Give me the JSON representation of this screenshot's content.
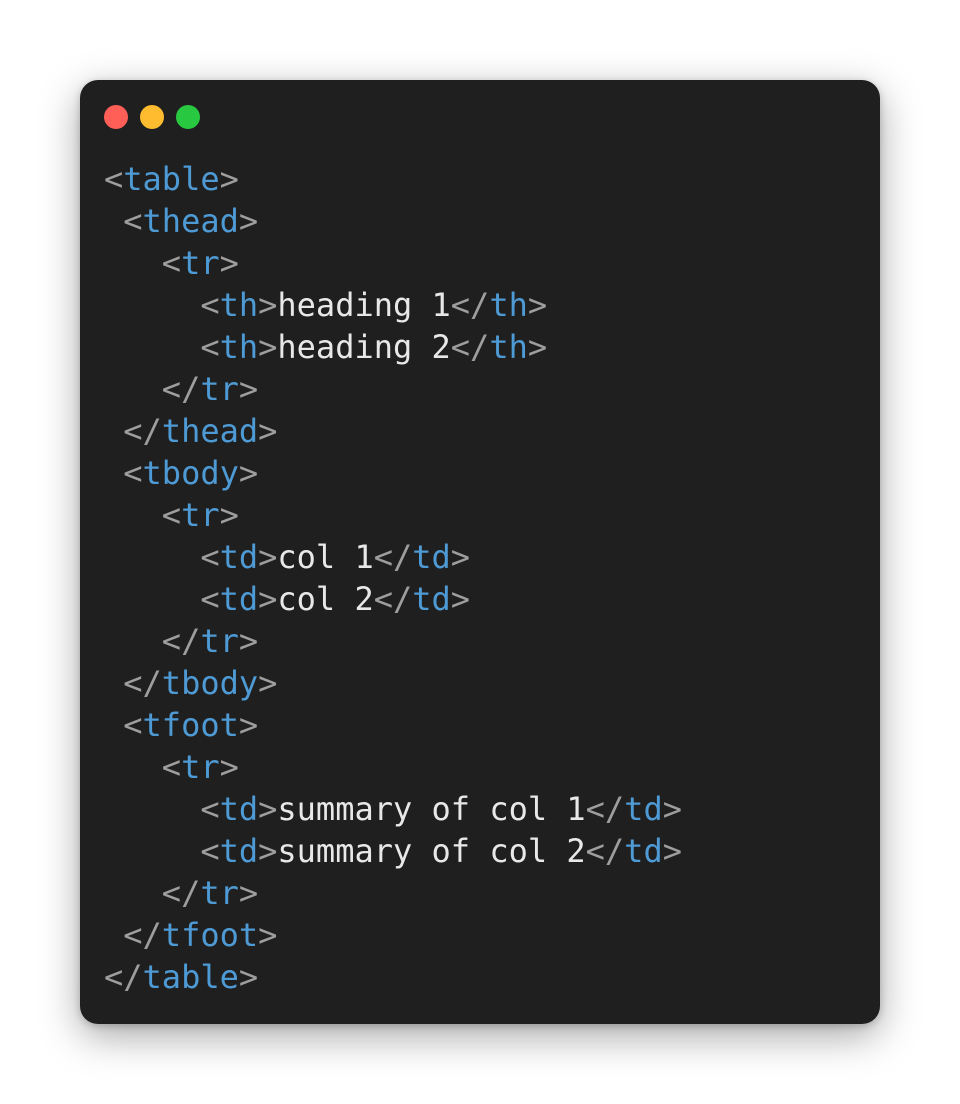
{
  "window_controls": {
    "close_color": "#ff5f57",
    "minimize_color": "#febc2e",
    "maximize_color": "#28c840"
  },
  "colors": {
    "background": "#1f1f1f",
    "punctuation": "#9e9e9e",
    "tag": "#4e9ad5",
    "text": "#e8e8e8"
  },
  "code": {
    "lines": [
      [
        {
          "t": "p",
          "v": "<"
        },
        {
          "t": "g",
          "v": "table"
        },
        {
          "t": "p",
          "v": ">"
        }
      ],
      [
        {
          "t": "s",
          "v": " "
        },
        {
          "t": "p",
          "v": "<"
        },
        {
          "t": "g",
          "v": "thead"
        },
        {
          "t": "p",
          "v": ">"
        }
      ],
      [
        {
          "t": "s",
          "v": "   "
        },
        {
          "t": "p",
          "v": "<"
        },
        {
          "t": "g",
          "v": "tr"
        },
        {
          "t": "p",
          "v": ">"
        }
      ],
      [
        {
          "t": "s",
          "v": "     "
        },
        {
          "t": "p",
          "v": "<"
        },
        {
          "t": "g",
          "v": "th"
        },
        {
          "t": "p",
          "v": ">"
        },
        {
          "t": "x",
          "v": "heading 1"
        },
        {
          "t": "p",
          "v": "</"
        },
        {
          "t": "g",
          "v": "th"
        },
        {
          "t": "p",
          "v": ">"
        }
      ],
      [
        {
          "t": "s",
          "v": "     "
        },
        {
          "t": "p",
          "v": "<"
        },
        {
          "t": "g",
          "v": "th"
        },
        {
          "t": "p",
          "v": ">"
        },
        {
          "t": "x",
          "v": "heading 2"
        },
        {
          "t": "p",
          "v": "</"
        },
        {
          "t": "g",
          "v": "th"
        },
        {
          "t": "p",
          "v": ">"
        }
      ],
      [
        {
          "t": "s",
          "v": "   "
        },
        {
          "t": "p",
          "v": "</"
        },
        {
          "t": "g",
          "v": "tr"
        },
        {
          "t": "p",
          "v": ">"
        }
      ],
      [
        {
          "t": "s",
          "v": " "
        },
        {
          "t": "p",
          "v": "</"
        },
        {
          "t": "g",
          "v": "thead"
        },
        {
          "t": "p",
          "v": ">"
        }
      ],
      [
        {
          "t": "s",
          "v": " "
        },
        {
          "t": "p",
          "v": "<"
        },
        {
          "t": "g",
          "v": "tbody"
        },
        {
          "t": "p",
          "v": ">"
        }
      ],
      [
        {
          "t": "s",
          "v": "   "
        },
        {
          "t": "p",
          "v": "<"
        },
        {
          "t": "g",
          "v": "tr"
        },
        {
          "t": "p",
          "v": ">"
        }
      ],
      [
        {
          "t": "s",
          "v": "     "
        },
        {
          "t": "p",
          "v": "<"
        },
        {
          "t": "g",
          "v": "td"
        },
        {
          "t": "p",
          "v": ">"
        },
        {
          "t": "x",
          "v": "col 1"
        },
        {
          "t": "p",
          "v": "</"
        },
        {
          "t": "g",
          "v": "td"
        },
        {
          "t": "p",
          "v": ">"
        }
      ],
      [
        {
          "t": "s",
          "v": "     "
        },
        {
          "t": "p",
          "v": "<"
        },
        {
          "t": "g",
          "v": "td"
        },
        {
          "t": "p",
          "v": ">"
        },
        {
          "t": "x",
          "v": "col 2"
        },
        {
          "t": "p",
          "v": "</"
        },
        {
          "t": "g",
          "v": "td"
        },
        {
          "t": "p",
          "v": ">"
        }
      ],
      [
        {
          "t": "s",
          "v": "   "
        },
        {
          "t": "p",
          "v": "</"
        },
        {
          "t": "g",
          "v": "tr"
        },
        {
          "t": "p",
          "v": ">"
        }
      ],
      [
        {
          "t": "s",
          "v": " "
        },
        {
          "t": "p",
          "v": "</"
        },
        {
          "t": "g",
          "v": "tbody"
        },
        {
          "t": "p",
          "v": ">"
        }
      ],
      [
        {
          "t": "s",
          "v": " "
        },
        {
          "t": "p",
          "v": "<"
        },
        {
          "t": "g",
          "v": "tfoot"
        },
        {
          "t": "p",
          "v": ">"
        }
      ],
      [
        {
          "t": "s",
          "v": "   "
        },
        {
          "t": "p",
          "v": "<"
        },
        {
          "t": "g",
          "v": "tr"
        },
        {
          "t": "p",
          "v": ">"
        }
      ],
      [
        {
          "t": "s",
          "v": "     "
        },
        {
          "t": "p",
          "v": "<"
        },
        {
          "t": "g",
          "v": "td"
        },
        {
          "t": "p",
          "v": ">"
        },
        {
          "t": "x",
          "v": "summary of col 1"
        },
        {
          "t": "p",
          "v": "</"
        },
        {
          "t": "g",
          "v": "td"
        },
        {
          "t": "p",
          "v": ">"
        }
      ],
      [
        {
          "t": "s",
          "v": "     "
        },
        {
          "t": "p",
          "v": "<"
        },
        {
          "t": "g",
          "v": "td"
        },
        {
          "t": "p",
          "v": ">"
        },
        {
          "t": "x",
          "v": "summary of col 2"
        },
        {
          "t": "p",
          "v": "</"
        },
        {
          "t": "g",
          "v": "td"
        },
        {
          "t": "p",
          "v": ">"
        }
      ],
      [
        {
          "t": "s",
          "v": "   "
        },
        {
          "t": "p",
          "v": "</"
        },
        {
          "t": "g",
          "v": "tr"
        },
        {
          "t": "p",
          "v": ">"
        }
      ],
      [
        {
          "t": "s",
          "v": " "
        },
        {
          "t": "p",
          "v": "</"
        },
        {
          "t": "g",
          "v": "tfoot"
        },
        {
          "t": "p",
          "v": ">"
        }
      ],
      [
        {
          "t": "p",
          "v": "</"
        },
        {
          "t": "g",
          "v": "table"
        },
        {
          "t": "p",
          "v": ">"
        }
      ]
    ]
  }
}
